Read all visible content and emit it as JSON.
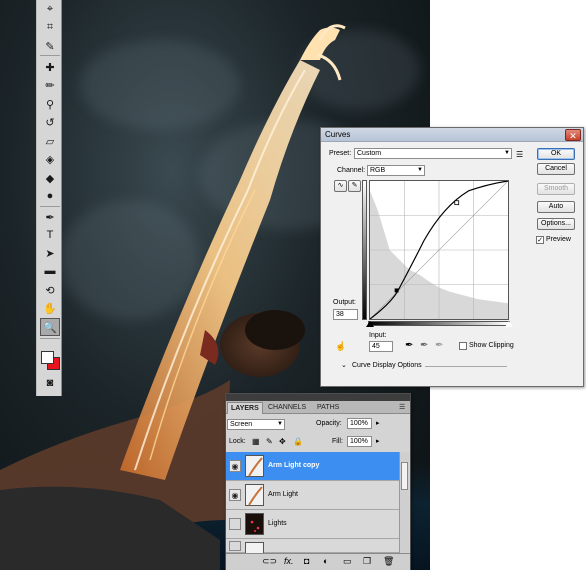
{
  "curves": {
    "title": "Curves",
    "preset_label": "Preset:",
    "preset_value": "Custom",
    "channel_label": "Channel:",
    "channel_value": "RGB",
    "output_label": "Output:",
    "output_value": "38",
    "input_label": "Input:",
    "input_value": "45",
    "show_clipping": "Show Clipping",
    "display_options": "Curve Display Options",
    "buttons": {
      "ok": "OK",
      "cancel": "Cancel",
      "smooth": "Smooth",
      "auto": "Auto",
      "options": "Options..."
    },
    "preview_label": "Preview",
    "preview_checked": true
  },
  "layers": {
    "tabs": [
      "LAYERS",
      "CHANNELS",
      "PATHS"
    ],
    "blend_mode": "Screen",
    "opacity_label": "Opacity:",
    "opacity_value": "100%",
    "lock_label": "Lock:",
    "fill_label": "Fill:",
    "fill_value": "100%",
    "items": [
      {
        "name": "Arm Light copy",
        "selected": true,
        "visible": true
      },
      {
        "name": "Arm Light",
        "selected": false,
        "visible": true
      },
      {
        "name": "Lights",
        "selected": false,
        "visible": false
      },
      {
        "name": "",
        "selected": false,
        "visible": false
      }
    ]
  },
  "colors": {
    "foreground": "#ffffff",
    "background": "#e8141b",
    "selection": "#3c8ef0"
  }
}
